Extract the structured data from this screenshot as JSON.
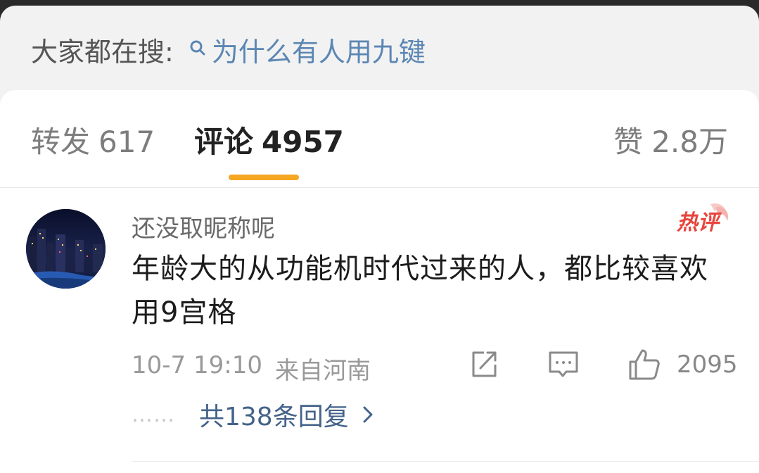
{
  "search_hint": {
    "label": "大家都在搜:",
    "query": "为什么有人用九键",
    "icon": "search-icon"
  },
  "tabs": {
    "repost": {
      "label": "转发",
      "count": "617"
    },
    "comment": {
      "label": "评论",
      "count": "4957"
    },
    "like": {
      "label": "赞",
      "count": "2.8万"
    },
    "active": "comment",
    "accent_color": "#f5a623"
  },
  "comment": {
    "username": "还没取昵称呢",
    "badge": "热评",
    "text": "年龄大的从功能机时代过来的人，都比较喜欢用9宫格",
    "time": "10-7 19:10",
    "location": "来自河南",
    "like_count": "2095",
    "replies_label": "共138条回复",
    "replies_dots": "……",
    "icons": [
      "share-icon",
      "comment-icon",
      "thumbs-up-icon",
      "chevron-right-icon"
    ]
  },
  "colors": {
    "link": "#5b86b3",
    "reply_link": "#44638a",
    "badge": "#e8453c"
  }
}
